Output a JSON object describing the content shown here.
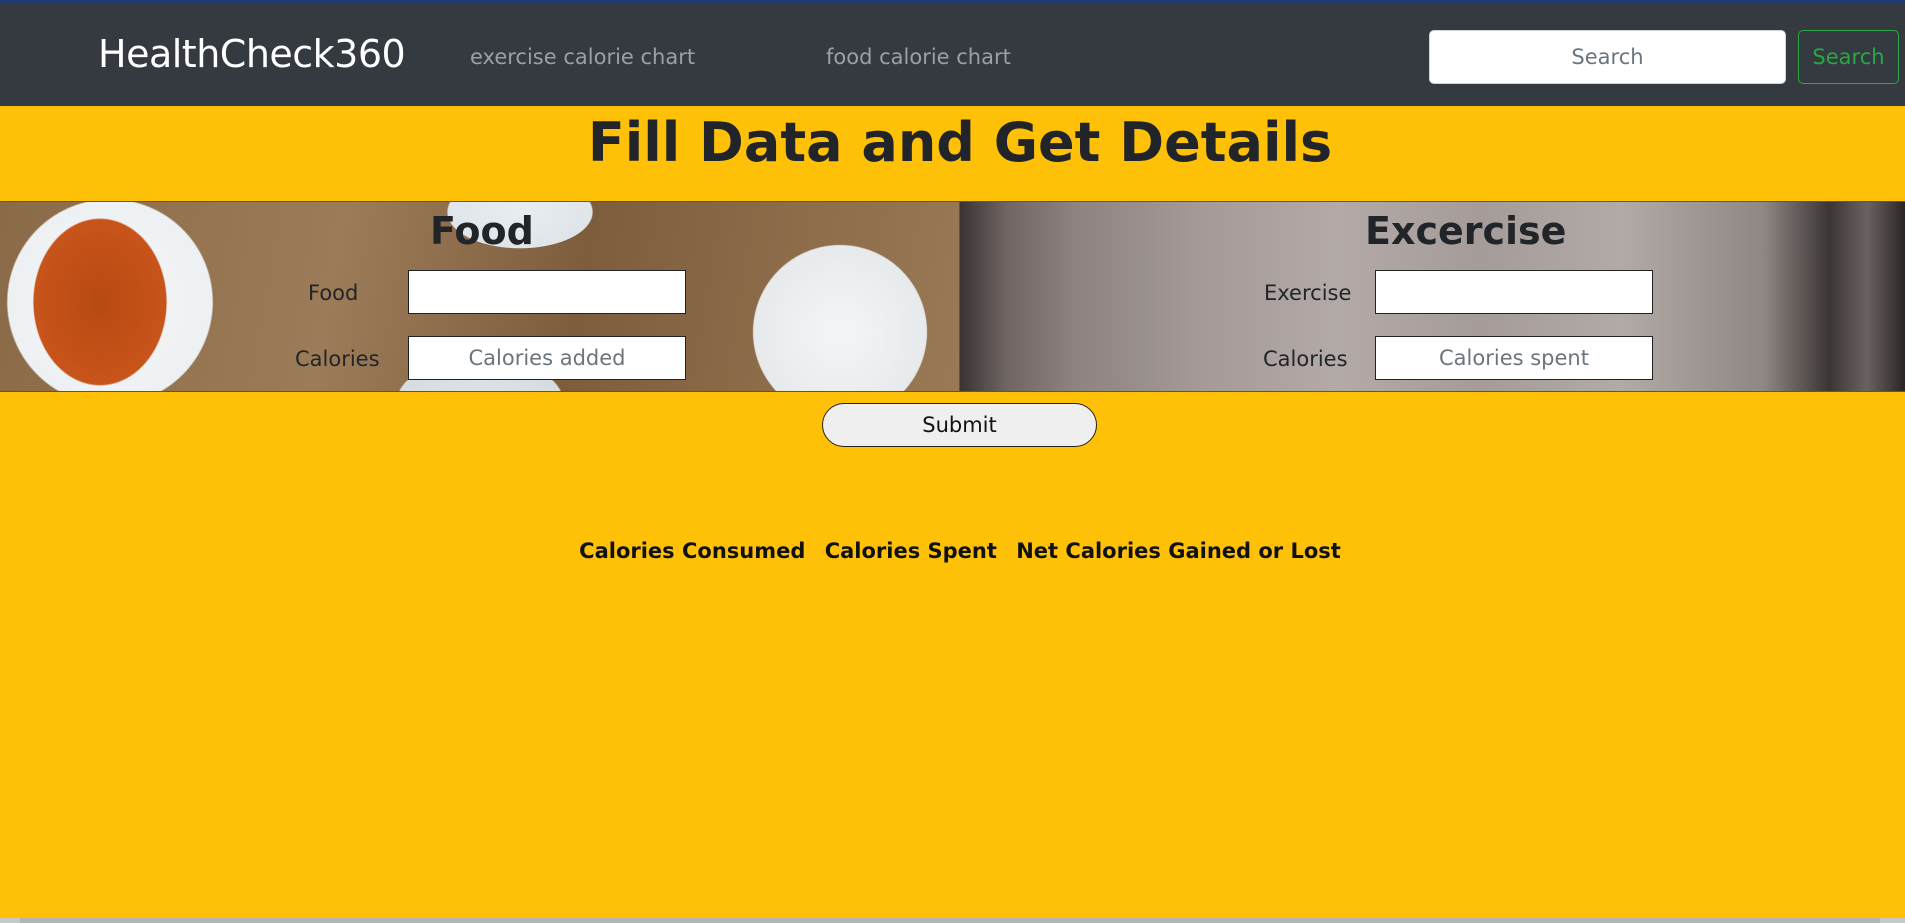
{
  "navbar": {
    "brand": "HealthCheck360",
    "links": [
      "exercise calorie chart",
      "food calorie chart"
    ],
    "search_placeholder": "Search",
    "search_button": "Search"
  },
  "page_title": "Fill Data and Get Details",
  "food_panel": {
    "heading": "Food",
    "food_label": "Food",
    "food_value": "",
    "calories_label": "Calories",
    "calories_placeholder": "Calories added"
  },
  "exercise_panel": {
    "heading": "Excercise",
    "exercise_label": "Exercise",
    "exercise_value": "",
    "calories_label": "Calories",
    "calories_placeholder": "Calories spent"
  },
  "submit_label": "Submit",
  "results": {
    "consumed": "Calories Consumed",
    "spent": "Calories Spent",
    "net": "Net Calories Gained or Lost"
  },
  "colors": {
    "background": "#ffc107",
    "navbar": "#343a40",
    "search_button": "#28a745"
  }
}
